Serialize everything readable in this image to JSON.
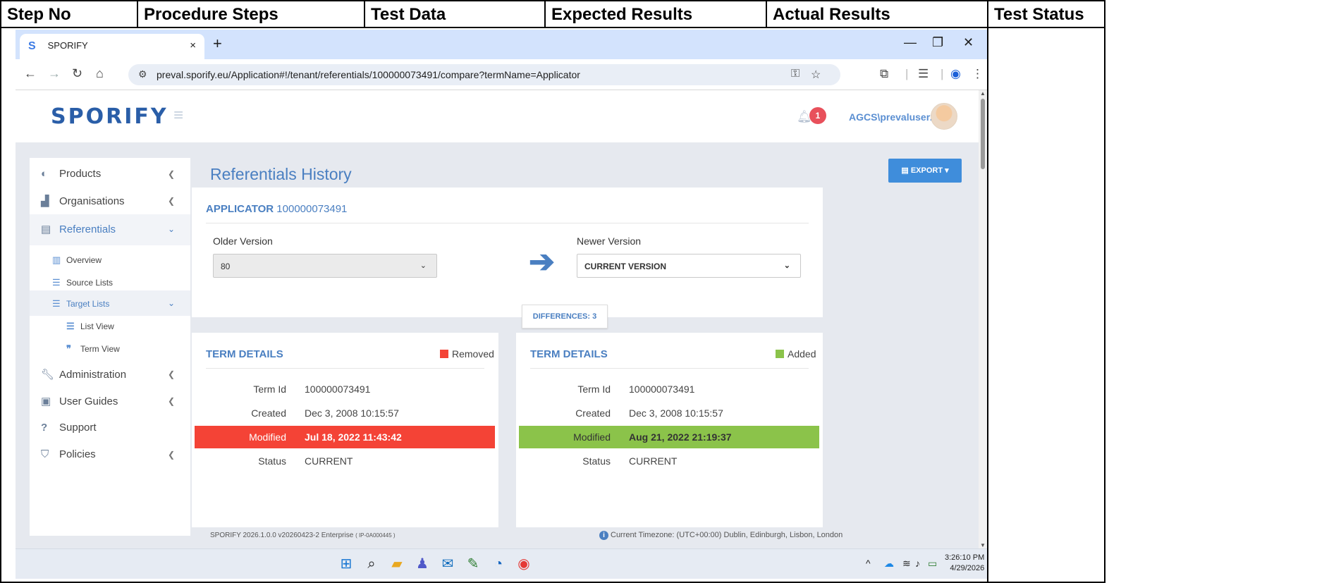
{
  "table": {
    "headers": [
      "Step No",
      "Procedure Steps",
      "Test Data",
      "Expected Results",
      "Actual Results",
      "Test Status"
    ]
  },
  "browser": {
    "tab_title": "SPORIFY",
    "tab_close": "×",
    "new_tab": "+",
    "url": "preval.sporify.eu/Application#!/tenant/referentials/100000073491/compare?termName=Applicator",
    "icons": [
      "back-icon",
      "forward-icon",
      "reload-icon",
      "home-icon",
      "site-settings-icon",
      "password-key-icon",
      "star-icon",
      "extensions-icon",
      "reading-mode-icon",
      "profile-icon",
      "menu-icon"
    ]
  },
  "app": {
    "logo": "SPORIFY",
    "notifications_count": "1",
    "username": "AGCS\\prevaluser2",
    "sidebar": {
      "items": [
        {
          "label": "Products",
          "icon": "pills-icon"
        },
        {
          "label": "Organisations",
          "icon": "factory-icon"
        },
        {
          "label": "Referentials",
          "icon": "book-icon"
        },
        {
          "label": "Administration",
          "icon": "wrench-icon"
        },
        {
          "label": "User Guides",
          "icon": "guide-icon"
        },
        {
          "label": "Support",
          "icon": "question-icon"
        },
        {
          "label": "Policies",
          "icon": "shield-icon"
        }
      ],
      "sub": {
        "overview": "Overview",
        "source_lists": "Source Lists",
        "target_lists": "Target Lists",
        "list_view": "List View",
        "term_view": "Term View"
      }
    },
    "page_title": "Referentials History",
    "export_label": "EXPORT",
    "compare": {
      "term_label": "APPLICATOR",
      "term_id": "100000073491",
      "older_label": "Older Version",
      "older_value": "80",
      "newer_label": "Newer Version",
      "newer_value": "CURRENT VERSION",
      "differences": "DIFFERENCES: 3"
    },
    "left_details": {
      "title": "TERM DETAILS",
      "legend": "Removed",
      "legend_color": "#f44336",
      "rows": [
        {
          "key": "Term Id",
          "value": "100000073491"
        },
        {
          "key": "Created",
          "value": "Dec 3, 2008 10:15:57"
        },
        {
          "key": "Modified",
          "value": "Jul 18, 2022 11:43:42"
        },
        {
          "key": "Status",
          "value": "CURRENT"
        }
      ]
    },
    "right_details": {
      "title": "TERM DETAILS",
      "legend": "Added",
      "legend_color": "#8bc34a",
      "rows": [
        {
          "key": "Term Id",
          "value": "100000073491"
        },
        {
          "key": "Created",
          "value": "Dec 3, 2008 10:15:57"
        },
        {
          "key": "Modified",
          "value": "Aug 21, 2022 21:19:37"
        },
        {
          "key": "Status",
          "value": "CURRENT"
        }
      ]
    },
    "footer": {
      "version": "SPORIFY 2026.1.0.0 v20260423-2 Enterprise",
      "ip": "( IP-0A000445 )",
      "timezone": "Current Timezone: (UTC+00:00) Dublin, Edinburgh, Lisbon, London"
    }
  },
  "taskbar": {
    "time": "3:26:10 PM",
    "date": "4/29/2026"
  }
}
